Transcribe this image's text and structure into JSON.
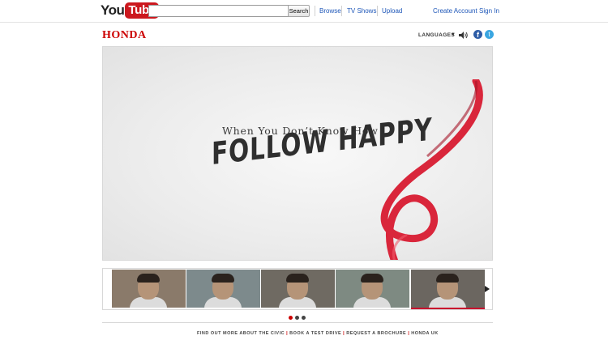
{
  "youtube": {
    "logo_you": "You",
    "logo_tube": "Tube",
    "search_value": "",
    "search_button": "Search",
    "nav": [
      "Browse",
      "TV Shows",
      "Upload"
    ],
    "create_account": "Create Account",
    "sign_in": "Sign In"
  },
  "honda": {
    "logo": "HONDA",
    "languages": "LANGUAGES",
    "facebook_glyph": "f",
    "twitter_glyph": "t"
  },
  "video": {
    "tagline_small": "When You Don’t Know How",
    "tagline_big": "FOLLOW HAPPY",
    "ribbon_color": "#d9263b"
  },
  "thumbnails": {
    "count": 5,
    "active_index": 4,
    "tones": [
      "#8a7a6a",
      "#7d8a8c",
      "#6f6a62",
      "#7e8a82",
      "#6b6660"
    ]
  },
  "pager": {
    "count": 3,
    "active_index": 0
  },
  "footer": {
    "links": [
      "FIND OUT MORE ABOUT THE CIVIC",
      "BOOK A TEST DRIVE",
      "REQUEST A BROCHURE",
      "HONDA UK"
    ],
    "separator": "|"
  },
  "colors": {
    "youtube_red": "#cc181e",
    "link_blue": "#1d56b8",
    "honda_red": "#cc0000"
  }
}
